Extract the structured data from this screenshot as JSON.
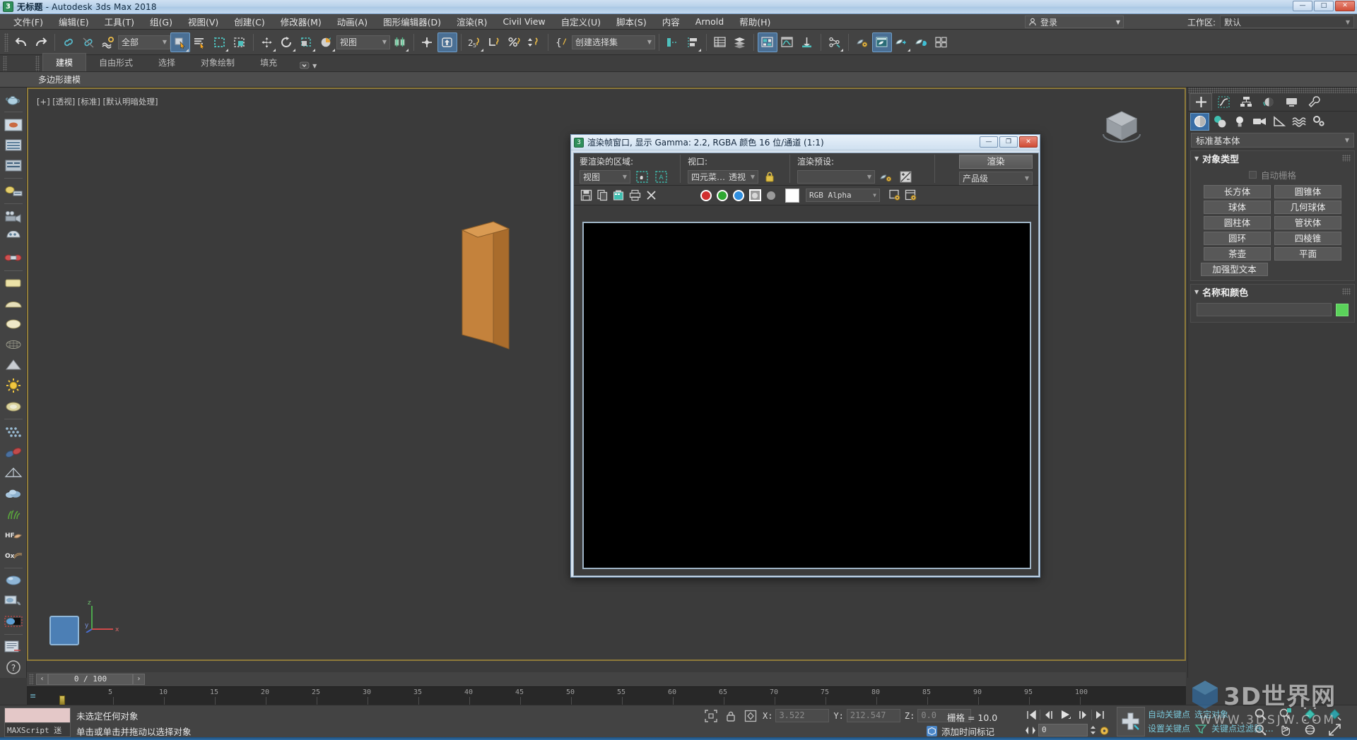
{
  "titlebar": {
    "doc_name": "无标题",
    "app_name": " - Autodesk 3ds Max 2018",
    "icon": "3dsmax-icon",
    "minimize": "—",
    "maximize": "□",
    "close": "✕"
  },
  "menubar": {
    "items": [
      {
        "label": "文件(F)",
        "name": "menu-file"
      },
      {
        "label": "编辑(E)",
        "name": "menu-edit"
      },
      {
        "label": "工具(T)",
        "name": "menu-tools"
      },
      {
        "label": "组(G)",
        "name": "menu-group"
      },
      {
        "label": "视图(V)",
        "name": "menu-views"
      },
      {
        "label": "创建(C)",
        "name": "menu-create"
      },
      {
        "label": "修改器(M)",
        "name": "menu-modifiers"
      },
      {
        "label": "动画(A)",
        "name": "menu-animation"
      },
      {
        "label": "图形编辑器(D)",
        "name": "menu-graph-editors"
      },
      {
        "label": "渲染(R)",
        "name": "menu-rendering"
      },
      {
        "label": "Civil View",
        "name": "menu-civil-view"
      },
      {
        "label": "自定义(U)",
        "name": "menu-customize"
      },
      {
        "label": "脚本(S)",
        "name": "menu-scripting"
      },
      {
        "label": "内容",
        "name": "menu-content"
      },
      {
        "label": "Arnold",
        "name": "menu-arnold"
      },
      {
        "label": "帮助(H)",
        "name": "menu-help"
      }
    ],
    "login_label": "登录",
    "workspace_label": "工作区:",
    "workspace_value": "默认"
  },
  "toolbar": {
    "selection_filter": "全部",
    "reference_coord": "视图",
    "named_selection_sets": "创建选择集",
    "buttons": [
      {
        "name": "undo-button",
        "icon": "undo-icon"
      },
      {
        "name": "redo-button",
        "icon": "redo-icon"
      },
      {
        "name": "select-and-link-button",
        "icon": "link-icon"
      },
      {
        "name": "unlink-selection-button",
        "icon": "unlink-icon"
      },
      {
        "name": "bind-to-space-warp-button",
        "icon": "space-warp-icon"
      },
      {
        "name": "select-object-button",
        "icon": "select-arrow-icon"
      },
      {
        "name": "select-by-name-button",
        "icon": "select-by-name-icon"
      },
      {
        "name": "rectangular-selection-region-button",
        "icon": "rect-region-icon"
      },
      {
        "name": "window-crossing-button",
        "icon": "window-crossing-icon"
      },
      {
        "name": "select-and-move-button",
        "icon": "move-icon"
      },
      {
        "name": "select-and-rotate-button",
        "icon": "rotate-icon"
      },
      {
        "name": "select-and-scale-button",
        "icon": "scale-icon"
      },
      {
        "name": "select-and-place-button",
        "icon": "place-icon"
      },
      {
        "name": "use-center-flyout-button",
        "icon": "pivot-center-icon"
      },
      {
        "name": "select-and-manipulate-button",
        "icon": "manipulate-icon"
      },
      {
        "name": "snaps-toggle-button",
        "icon": "snap-2d5-icon"
      },
      {
        "name": "angle-snap-toggle-button",
        "icon": "angle-snap-icon"
      },
      {
        "name": "percent-snap-toggle-button",
        "icon": "percent-snap-icon"
      },
      {
        "name": "spinner-snap-toggle-button",
        "icon": "spinner-snap-icon"
      },
      {
        "name": "edit-named-selection-sets-button",
        "icon": "named-set-icon"
      },
      {
        "name": "mirror-button",
        "icon": "mirror-icon"
      },
      {
        "name": "align-button",
        "icon": "align-icon"
      },
      {
        "name": "layer-explorer-button",
        "icon": "layers-icon"
      },
      {
        "name": "toggle-scene-explorer-button",
        "icon": "scene-explorer-icon"
      },
      {
        "name": "toggle-ribbon-button",
        "icon": "ribbon-icon"
      },
      {
        "name": "curve-editor-button",
        "icon": "curve-editor-icon"
      },
      {
        "name": "schematic-view-button",
        "icon": "schematic-view-icon"
      },
      {
        "name": "material-editor-button",
        "icon": "material-editor-icon"
      },
      {
        "name": "render-setup-button",
        "icon": "render-setup-icon"
      },
      {
        "name": "rendered-frame-window-button",
        "icon": "render-frame-icon"
      },
      {
        "name": "render-production-button",
        "icon": "render-production-icon"
      },
      {
        "name": "render-iterative-button",
        "icon": "render-iterative-icon"
      },
      {
        "name": "quad-view-button",
        "icon": "quad-view-icon"
      }
    ]
  },
  "ribbon": {
    "tabs": [
      {
        "label": "建模",
        "name": "ribbon-tab-modeling",
        "selected": true
      },
      {
        "label": "自由形式",
        "name": "ribbon-tab-freeform",
        "selected": false
      },
      {
        "label": "选择",
        "name": "ribbon-tab-selection",
        "selected": false
      },
      {
        "label": "对象绘制",
        "name": "ribbon-tab-object-paint",
        "selected": false
      },
      {
        "label": "填充",
        "name": "ribbon-tab-populate",
        "selected": false
      }
    ],
    "panel_label": "多边形建模"
  },
  "viewport": {
    "label": "[+] [透视] [标准] [默认明暗处理]",
    "object": "box-mesh",
    "object_color": "#c98b42",
    "border_color": "#8d7a3a"
  },
  "render_window": {
    "title": "渲染帧窗口, 显示 Gamma: 2.2, RGBA 颜色 16 位/通道 (1:1)",
    "icon": "3dsmax-icon",
    "minimize": "—",
    "maximize": "❐",
    "close": "✕",
    "area_to_render_label": "要渲染的区域:",
    "area_to_render_value": "视图",
    "viewport_label": "视口:",
    "viewport_value_left": "四元菜…",
    "viewport_value_right": "透视",
    "preset_label": "渲染预设:",
    "preset_value": "",
    "render_button": "渲染",
    "render_level": "产品级",
    "channel_dropdown": "RGB Alpha",
    "toolbar_buttons": [
      {
        "name": "save-image-button",
        "icon": "save-icon"
      },
      {
        "name": "copy-image-button",
        "icon": "copy-icon"
      },
      {
        "name": "clone-rendered-frame-button",
        "icon": "clone-icon"
      },
      {
        "name": "print-image-button",
        "icon": "print-icon"
      },
      {
        "name": "clear-button",
        "icon": "close-x-icon"
      },
      {
        "name": "red-channel-button",
        "icon": "red-channel-icon"
      },
      {
        "name": "green-channel-button",
        "icon": "green-channel-icon"
      },
      {
        "name": "blue-channel-button",
        "icon": "blue-channel-icon"
      },
      {
        "name": "alpha-channel-button",
        "icon": "alpha-channel-icon"
      },
      {
        "name": "monochrome-button",
        "icon": "mono-channel-icon"
      },
      {
        "name": "background-color-swatch",
        "icon": "color-swatch-icon"
      },
      {
        "name": "enable-red-button",
        "icon": "enable-red-icon"
      },
      {
        "name": "duplicate-bitmap-button",
        "icon": "duplicate-icon"
      }
    ],
    "lock_icon": "lock-icon",
    "canvas_color": "#000000"
  },
  "command_panel": {
    "tabs": [
      {
        "name": "create-tab",
        "icon": "plus-icon",
        "selected": true
      },
      {
        "name": "modify-tab",
        "icon": "modify-icon",
        "selected": false
      },
      {
        "name": "hierarchy-tab",
        "icon": "hierarchy-icon",
        "selected": false
      },
      {
        "name": "motion-tab",
        "icon": "motion-icon",
        "selected": false
      },
      {
        "name": "display-tab",
        "icon": "display-icon",
        "selected": false
      },
      {
        "name": "utilities-tab",
        "icon": "wrench-icon",
        "selected": false
      }
    ],
    "categories": [
      {
        "name": "geometry-category",
        "icon": "sphere-icon",
        "selected": true
      },
      {
        "name": "shapes-category",
        "icon": "shapes-icon",
        "selected": false
      },
      {
        "name": "lights-category",
        "icon": "lightbulb-icon",
        "selected": false
      },
      {
        "name": "cameras-category",
        "icon": "camera-icon",
        "selected": false
      },
      {
        "name": "helpers-category",
        "icon": "helper-icon",
        "selected": false
      },
      {
        "name": "space-warps-category",
        "icon": "space-warp-icon",
        "selected": false
      },
      {
        "name": "systems-category",
        "icon": "systems-icon",
        "selected": false
      }
    ],
    "subcategory": "标准基本体",
    "object_type_rollout": {
      "title": "对象类型",
      "autogrid_label": "自动栅格",
      "autogrid_checked": false,
      "buttons": [
        "长方体",
        "圆锥体",
        "球体",
        "几何球体",
        "圆柱体",
        "管状体",
        "圆环",
        "四棱锥",
        "茶壶",
        "平面",
        "加强型文本"
      ]
    },
    "name_color_rollout": {
      "title": "名称和颜色",
      "name_value": "",
      "color": "#5ad35a"
    }
  },
  "timeline": {
    "current_frame_display": "0 / 100",
    "prev_label": "‹",
    "next_label": "›",
    "tick_labels": [
      "5",
      "10",
      "15",
      "20",
      "25",
      "30",
      "35",
      "40",
      "45",
      "50",
      "55",
      "60",
      "65",
      "70",
      "75",
      "80",
      "85",
      "90",
      "95",
      "100"
    ]
  },
  "statusbar": {
    "maxscript_listener": "MAXScript 迷",
    "status_line_1": "未选定任何对象",
    "status_line_2": "单击或单击并拖动以选择对象",
    "coords": [
      {
        "label": "X:",
        "value": "3.522",
        "name": "x-coordinate-field"
      },
      {
        "label": "Y:",
        "value": "212.547",
        "name": "y-coordinate-field"
      },
      {
        "label": "Z:",
        "value": "0.0",
        "name": "z-coordinate-field"
      }
    ],
    "grid_label": "栅格 = 10.0",
    "add_time_tag": "添加时间标记",
    "auto_key": "自动关键点",
    "set_key": "设置关键点",
    "selected_object": "选定对象",
    "key_filters": "关键点过滤器 …",
    "frame_value": "0",
    "playback_buttons": [
      {
        "name": "go-to-start-button",
        "icon": "skip-start-icon"
      },
      {
        "name": "previous-frame-button",
        "icon": "step-back-icon"
      },
      {
        "name": "play-animation-button",
        "icon": "play-icon"
      },
      {
        "name": "next-frame-button",
        "icon": "step-forward-icon"
      },
      {
        "name": "go-to-end-button",
        "icon": "skip-end-icon"
      }
    ],
    "nav_buttons": [
      {
        "name": "zoom-button",
        "icon": "magnifier-icon"
      },
      {
        "name": "zoom-all-button",
        "icon": "zoom-all-icon"
      },
      {
        "name": "zoom-extents-button",
        "icon": "zoom-extents-icon"
      },
      {
        "name": "zoom-region-button",
        "icon": "zoom-region-icon"
      },
      {
        "name": "field-of-view-button",
        "icon": "fov-icon"
      },
      {
        "name": "pan-view-button",
        "icon": "hand-icon"
      },
      {
        "name": "orbit-button",
        "icon": "orbit-icon"
      },
      {
        "name": "maximize-viewport-toggle-button",
        "icon": "maximize-viewport-icon"
      }
    ]
  },
  "watermark": {
    "line1": "3D世界网",
    "line2": "WWW.3DSJW.COM"
  },
  "colors": {
    "accent_blue": "#3a6ea5",
    "panel_bg": "#3b3b3b",
    "toolbar_bg": "#434343",
    "viewport_bg": "#3b3b3b",
    "title_blue": "#aac8e4",
    "object_orange": "#c98b42",
    "green_swatch": "#5ad35a"
  }
}
